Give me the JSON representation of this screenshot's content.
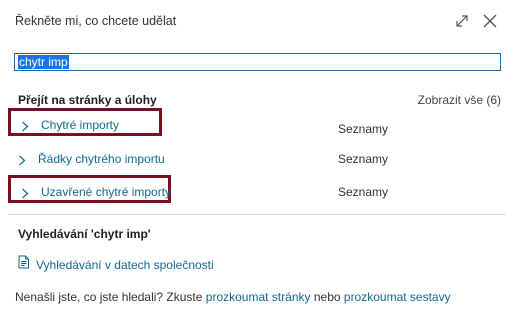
{
  "dialog": {
    "title": "Řekněte mi, co chcete udělat"
  },
  "search": {
    "value": "chytr imp"
  },
  "pages_section": {
    "heading": "Přejít na stránky a úlohy",
    "show_all": "Zobrazit vše (6)",
    "items": [
      {
        "label": "Chytré importy",
        "category": "Seznamy",
        "highlighted": true
      },
      {
        "label": "Řádky chytrého importu",
        "category": "Seznamy",
        "highlighted": false
      },
      {
        "label": "Uzavřené chytré importy",
        "category": "Seznamy",
        "highlighted": true
      }
    ]
  },
  "search_section": {
    "heading": "Vyhledávání 'chytr imp'",
    "company_search_label": "Vyhledávání v datech společnosti"
  },
  "footer": {
    "prefix": "Nenašli jste, co jste hledali? Zkuste",
    "explore_pages": "prozkoumat stránky",
    "connector": "nebo",
    "explore_reports": "prozkoumat sestavy"
  },
  "colors": {
    "link": "#0f6b8f",
    "highlight_border": "#7a0f1f",
    "search_border": "#1a6ca8"
  }
}
